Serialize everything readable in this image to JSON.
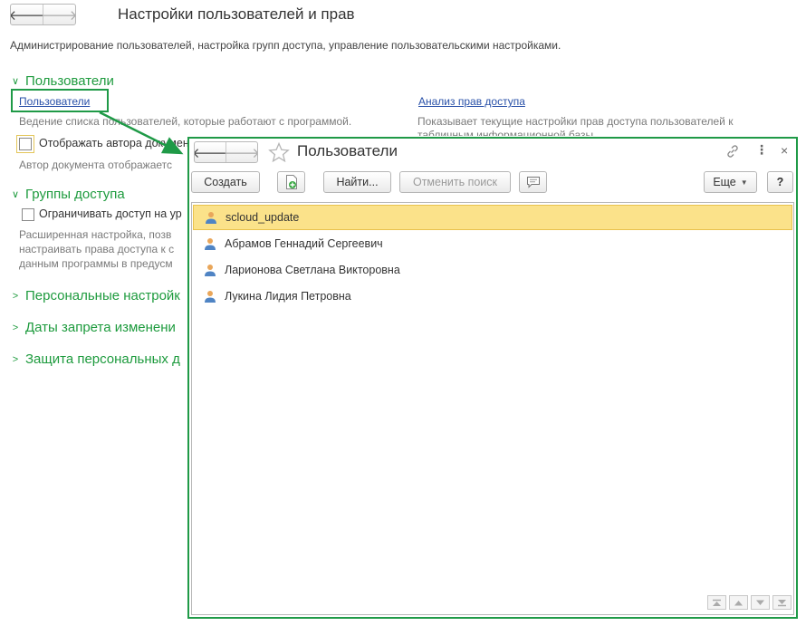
{
  "main": {
    "title": "Настройки пользователей и прав",
    "description": "Администрирование пользователей, настройка групп доступа, управление пользовательскими настройками.",
    "groups": {
      "users": {
        "header": "Пользователи",
        "link_users": "Пользователи",
        "link_users_hint": "Ведение списка пользователей, которые работают с программой.",
        "checkbox_author": "Отображать автора документ",
        "checkbox_author_hint": "Автор документа отображаетс",
        "link_access_analysis": "Анализ прав доступа",
        "access_hint_1": "Показывает текущие настройки прав доступа пользователей к",
        "access_hint_2": "табличным информационной базы"
      },
      "access_groups": {
        "header": "Группы доступа",
        "checkbox_restrict": "Ограничивать доступ на ур",
        "hint_1": "Расширенная настройка, позв",
        "hint_2": "настраивать права доступа к с",
        "hint_3": "данным программы в предусм"
      },
      "personal": {
        "header": "Персональные настройк"
      },
      "dates": {
        "header": "Даты запрета изменени"
      },
      "protection": {
        "header": "Защита персональных д"
      }
    }
  },
  "window": {
    "title": "Пользователи",
    "toolbar": {
      "create": "Создать",
      "find": "Найти...",
      "cancel_search": "Отменить поиск",
      "more": "Еще",
      "help": "?"
    },
    "users": [
      {
        "name": "scloud_update",
        "selected": true
      },
      {
        "name": "Абрамов Геннадий Сергеевич",
        "selected": false
      },
      {
        "name": "Ларионова Светлана Викторовна",
        "selected": false
      },
      {
        "name": "Лукина Лидия Петровна",
        "selected": false
      }
    ]
  },
  "colors": {
    "accent_green": "#1f9a47",
    "link_blue": "#2850a8",
    "selection": "#fbe28a"
  }
}
